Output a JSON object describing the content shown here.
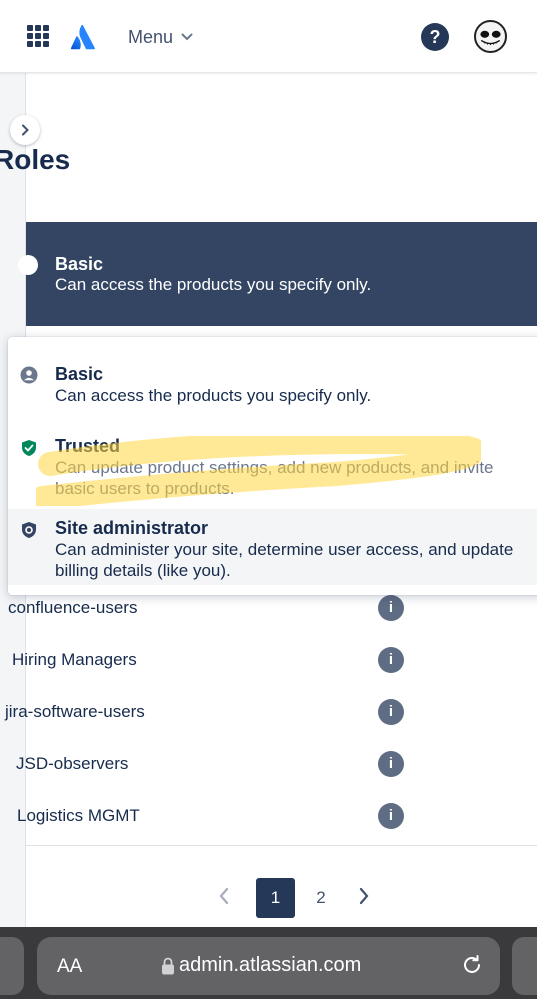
{
  "nav": {
    "menu_label": "Menu",
    "help_symbol": "?"
  },
  "page": {
    "title": "Roles"
  },
  "selected_role": {
    "name": "Basic",
    "description": "Can access the products you specify only."
  },
  "roles": [
    {
      "name": "Basic",
      "description": "Can access the products you specify only.",
      "icon": "user-icon"
    },
    {
      "name": "Trusted",
      "description": "Can update product settings, add new products, and invite basic users to products.",
      "icon": "shield-check-icon",
      "color": "#00875a"
    },
    {
      "name": "Site administrator",
      "description": "Can administer your site, determine user access, and update billing details (like you).",
      "icon": "shield-gear-icon"
    }
  ],
  "groups": [
    {
      "name": "confluence-users"
    },
    {
      "name": "Hiring Managers"
    },
    {
      "name": "jira-software-users"
    },
    {
      "name": "JSD-observers"
    },
    {
      "name": "Logistics MGMT"
    }
  ],
  "pagination": {
    "pages": [
      "1",
      "2"
    ],
    "current": "1",
    "prev_symbol": "‹",
    "next_symbol": "›"
  },
  "browser": {
    "text_size_label": "AA",
    "url": "admin.atlassian.com"
  },
  "colors": {
    "brand": "#0052cc",
    "dark_card": "#344563",
    "highlight": "#ffd740"
  }
}
